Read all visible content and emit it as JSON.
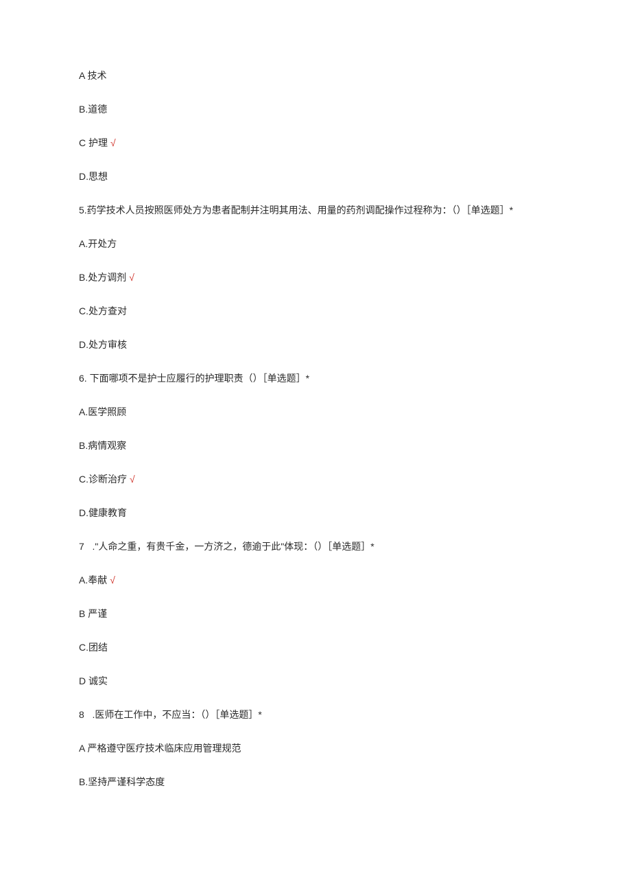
{
  "checkmark": "√",
  "lines": [
    {
      "text": "A 技术",
      "correct": false
    },
    {
      "text": "B.道德",
      "correct": false
    },
    {
      "text": "C 护理",
      "correct": true
    },
    {
      "text": "D.思想",
      "correct": false
    },
    {
      "text": "5.药学技术人员按照医师处方为患者配制并注明其用法、用量的药剂调配操作过程称为：（）［单选题］*",
      "correct": false
    },
    {
      "text": "A.开处方",
      "correct": false
    },
    {
      "text": "B.处方调剂",
      "correct": true
    },
    {
      "text": "C.处方查对",
      "correct": false
    },
    {
      "text": "D.处方审核",
      "correct": false
    },
    {
      "text": "6. 下面哪项不是护士应履行的护理职责（）［单选题］*",
      "correct": false
    },
    {
      "text": "A.医学照顾",
      "correct": false
    },
    {
      "text": "B.病情观察",
      "correct": false
    },
    {
      "text": "C.诊断治疗",
      "correct": true
    },
    {
      "text": "D.健康教育",
      "correct": false
    },
    {
      "text": "7   .\"人命之重，有贵千金，一方济之，德逾于此\"体现：（）［单选题］*",
      "correct": false
    },
    {
      "text": "A.奉献",
      "correct": true
    },
    {
      "text": "B 严谨",
      "correct": false
    },
    {
      "text": "C.团结",
      "correct": false
    },
    {
      "text": "D 诚实",
      "correct": false
    },
    {
      "text": "8   .医师在工作中，不应当：（）［单选题］*",
      "correct": false
    },
    {
      "text": "A 严格遵守医疗技术临床应用管理规范",
      "correct": false
    },
    {
      "text": "B.坚持严谨科学态度",
      "correct": false
    }
  ]
}
